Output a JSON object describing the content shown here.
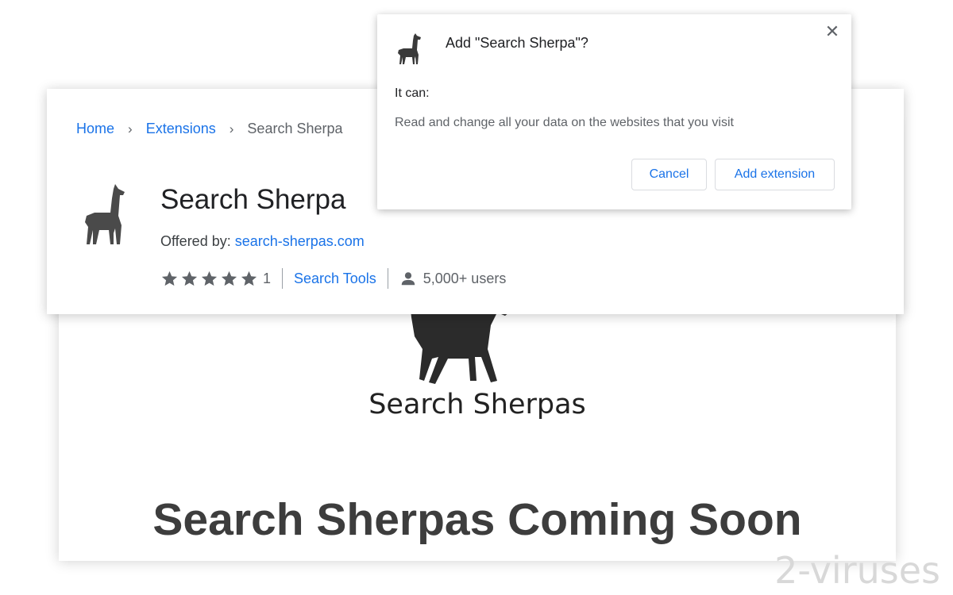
{
  "landing": {
    "logo_text": "Search Sherpas",
    "headline": "Search Sherpas Coming Soon"
  },
  "store": {
    "breadcrumb": {
      "home": "Home",
      "extensions": "Extensions",
      "current": "Search Sherpa"
    },
    "extension": {
      "name": "Search Sherpa",
      "offered_by_label": "Offered by:",
      "offered_by_link": "search-sherpas.com",
      "rating_stars": 5,
      "rating_count": "1",
      "category": "Search Tools",
      "users": "5,000+ users"
    },
    "icons": {
      "extension_icon": "llama-icon",
      "star": "star-icon",
      "users": "person-icon",
      "separator": "chevron-right-icon"
    }
  },
  "dialog": {
    "title": "Add \"Search Sherpa\"?",
    "it_can": "It can:",
    "permission": "Read and change all your data on the websites that you visit",
    "cancel_label": "Cancel",
    "add_label": "Add extension",
    "close_icon": "close-icon"
  },
  "watermark": "2-viruses",
  "colors": {
    "link_blue": "#1a73e8",
    "text_dark": "#202124",
    "text_gray": "#5f6368",
    "star_gray": "#5f6368"
  }
}
